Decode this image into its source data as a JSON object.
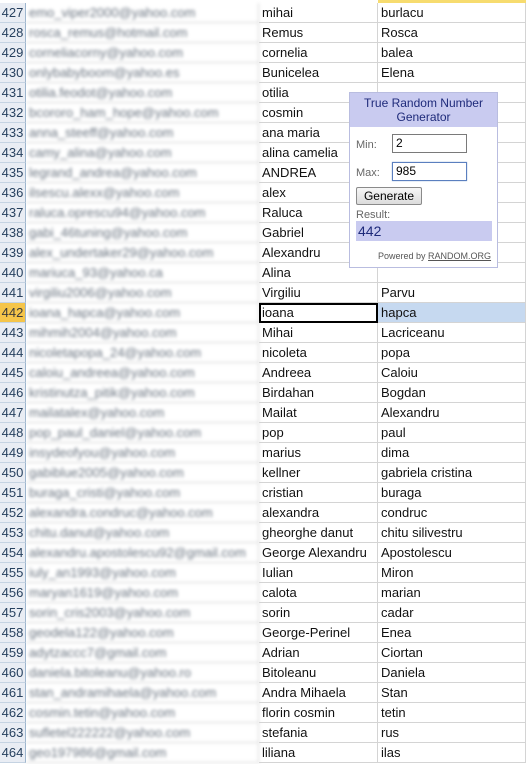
{
  "rows": [
    {
      "num": "427",
      "email": "emo_viper2000@yahoo.com",
      "first": "mihai",
      "last": "burlacu"
    },
    {
      "num": "428",
      "email": "rosca_remus@hotmail.com",
      "first": "Remus",
      "last": "Rosca"
    },
    {
      "num": "429",
      "email": "corneliacorny@yahoo.com",
      "first": "cornelia",
      "last": "balea"
    },
    {
      "num": "430",
      "email": "onlybabyboom@yahoo.es",
      "first": "Bunicelea",
      "last": "Elena"
    },
    {
      "num": "431",
      "email": "otilia.feodot@yahoo.com",
      "first": "otilia",
      "last": ""
    },
    {
      "num": "432",
      "email": "bcororo_ham_hope@yahoo.com",
      "first": "cosmin",
      "last": ""
    },
    {
      "num": "433",
      "email": "anna_steeff@yahoo.com",
      "first": "ana maria",
      "last": ""
    },
    {
      "num": "434",
      "email": "camy_alina@yahoo.com",
      "first": "alina camelia",
      "last": ""
    },
    {
      "num": "435",
      "email": "legrand_andrea@yahoo.com",
      "first": "ANDREA",
      "last": ""
    },
    {
      "num": "436",
      "email": "ilsescu.alexx@yahoo.com",
      "first": "alex",
      "last": ""
    },
    {
      "num": "437",
      "email": "raluca.oprescu94@yahoo.com",
      "first": "Raluca",
      "last": ""
    },
    {
      "num": "438",
      "email": "gabi_46tuning@yahoo.com",
      "first": "Gabriel",
      "last": ""
    },
    {
      "num": "439",
      "email": "alex_undertaker29@yahoo.com",
      "first": "Alexandru",
      "last": ""
    },
    {
      "num": "440",
      "email": "mariuca_93@yahoo.ca",
      "first": "Alina",
      "last": ""
    },
    {
      "num": "441",
      "email": "virgiliu2006@yahoo.com",
      "first": "Virgiliu",
      "last": "Parvu"
    },
    {
      "num": "442",
      "email": "ioana_hapca@yahoo.com",
      "first": "ioana",
      "last": "hapca"
    },
    {
      "num": "443",
      "email": "mihmih2004@yahoo.com",
      "first": "Mihai",
      "last": "Lacriceanu"
    },
    {
      "num": "444",
      "email": "nicoletapopa_24@yahoo.com",
      "first": "nicoleta",
      "last": "popa"
    },
    {
      "num": "445",
      "email": "caloiu_andreea@yahoo.com",
      "first": "Andreea",
      "last": "Caloiu"
    },
    {
      "num": "446",
      "email": "kristinutza_pitik@yahoo.com",
      "first": "Birdahan",
      "last": "Bogdan"
    },
    {
      "num": "447",
      "email": "mailatalex@yahoo.com",
      "first": "Mailat",
      "last": "Alexandru"
    },
    {
      "num": "448",
      "email": "pop_paul_daniel@yahoo.com",
      "first": "pop",
      "last": "paul"
    },
    {
      "num": "449",
      "email": "insydeofyou@yahoo.com",
      "first": "marius",
      "last": "dima"
    },
    {
      "num": "450",
      "email": "gabiblue2005@yahoo.com",
      "first": "kellner",
      "last": "gabriela cristina"
    },
    {
      "num": "451",
      "email": "buraga_cristi@yahoo.com",
      "first": "cristian",
      "last": "buraga"
    },
    {
      "num": "452",
      "email": "alexandra.condruc@yahoo.com",
      "first": "alexandra",
      "last": "condruc"
    },
    {
      "num": "453",
      "email": "chitu.danut@yahoo.com",
      "first": "gheorghe danut",
      "last": "chitu silivestru"
    },
    {
      "num": "454",
      "email": "alexandru.apostolescu92@gmail.com",
      "first": "George Alexandru",
      "last": "Apostolescu"
    },
    {
      "num": "455",
      "email": "iuly_an1993@yahoo.com",
      "first": "Iulian",
      "last": "Miron"
    },
    {
      "num": "456",
      "email": "maryan1619@yahoo.com",
      "first": "calota",
      "last": "marian"
    },
    {
      "num": "457",
      "email": "sorin_cris2003@yahoo.com",
      "first": "sorin",
      "last": "cadar"
    },
    {
      "num": "458",
      "email": "geodela122@yahoo.com",
      "first": "George-Perinel",
      "last": "Enea"
    },
    {
      "num": "459",
      "email": "adytzaccc7@gmail.com",
      "first": "Adrian",
      "last": "Ciortan"
    },
    {
      "num": "460",
      "email": "daniela.bitoleanu@yahoo.ro",
      "first": "Bitoleanu",
      "last": "Daniela"
    },
    {
      "num": "461",
      "email": "stan_andramihaela@yahoo.com",
      "first": "Andra Mihaela",
      "last": "Stan"
    },
    {
      "num": "462",
      "email": "cosmin.tetin@yahoo.com",
      "first": "florin cosmin",
      "last": "tetin"
    },
    {
      "num": "463",
      "email": "sufletel222222@yahoo.com",
      "first": "stefania",
      "last": "rus"
    },
    {
      "num": "464",
      "email": "geo197986@gmail.com",
      "first": "liliana",
      "last": "ilas"
    }
  ],
  "rng": {
    "title": "True Random Number Generator",
    "min_label": "Min:",
    "min_value": "2",
    "max_label": "Max:",
    "max_value": "985",
    "generate_label": "Generate",
    "result_label": "Result:",
    "result_value": "442",
    "powered_prefix": "Powered by",
    "powered_link": "RANDOM.ORG"
  },
  "colors": {
    "selected_row_header": "#f5c54a",
    "widget_accent": "#c9cbf0",
    "selected_cell": "#c6d9f0"
  }
}
